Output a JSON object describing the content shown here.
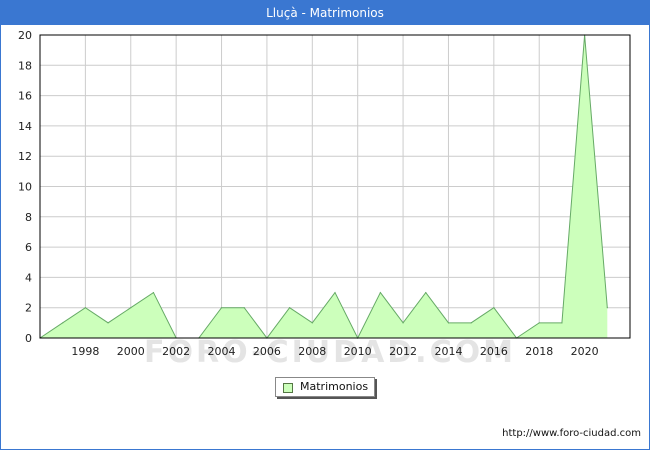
{
  "window": {
    "title": "Lluçà - Matrimonios"
  },
  "watermark": "FORO-CIUDAD.COM",
  "footer": {
    "url": "http://www.foro-ciudad.com"
  },
  "colors": {
    "title_bar": "#3a77d1",
    "area_fill": "#ccffbb",
    "area_line": "#66aa66",
    "grid": "#cccccc"
  },
  "chart_data": {
    "type": "area",
    "title": "Lluçà - Matrimonios",
    "xlabel": "",
    "ylabel": "",
    "x": [
      1996,
      1997,
      1998,
      1999,
      2000,
      2001,
      2002,
      2003,
      2004,
      2005,
      2006,
      2007,
      2008,
      2009,
      2010,
      2011,
      2012,
      2013,
      2014,
      2015,
      2016,
      2017,
      2018,
      2019,
      2020,
      2021
    ],
    "series": [
      {
        "name": "Matrimonios",
        "values": [
          0,
          1,
          2,
          1,
          2,
          3,
          0,
          0,
          2,
          2,
          0,
          2,
          1,
          3,
          0,
          3,
          1,
          3,
          1,
          1,
          2,
          0,
          1,
          1,
          20,
          2
        ]
      }
    ],
    "x_ticks": [
      1998,
      2000,
      2002,
      2004,
      2006,
      2008,
      2010,
      2012,
      2014,
      2016,
      2018,
      2020
    ],
    "y_ticks": [
      0,
      2,
      4,
      6,
      8,
      10,
      12,
      14,
      16,
      18,
      20
    ],
    "ylim": [
      0,
      20
    ],
    "xlim": [
      1996,
      2022
    ],
    "grid": true,
    "legend_position": "bottom-center"
  }
}
